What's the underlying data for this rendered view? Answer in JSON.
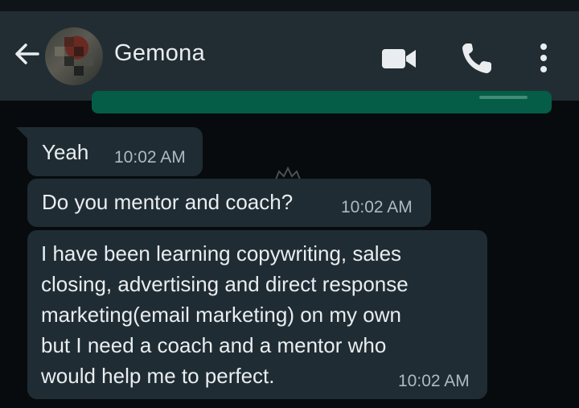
{
  "header": {
    "contact_name": "Gemona",
    "back_icon": "arrow-left-icon",
    "video_icon": "video-call-icon",
    "call_icon": "phone-icon",
    "menu_icon": "more-vertical-icon"
  },
  "messages": [
    {
      "text": "Yeah",
      "time": "10:02 AM"
    },
    {
      "text": "Do you mentor and coach?",
      "time": "10:02 AM"
    },
    {
      "text": "I have been learning copywriting, sales\nclosing, advertising and direct response\nmarketing(email marketing) on my own\nbut I need a coach and a mentor who\nwould help me to perfect.",
      "time": "10:02 AM"
    }
  ],
  "colors": {
    "app_bar": "#222d33",
    "background": "#070b0d",
    "incoming_bubble": "#1f2c33",
    "outgoing_bubble": "#055d47",
    "text": "#e9edef",
    "time_text": "#aebac1"
  }
}
